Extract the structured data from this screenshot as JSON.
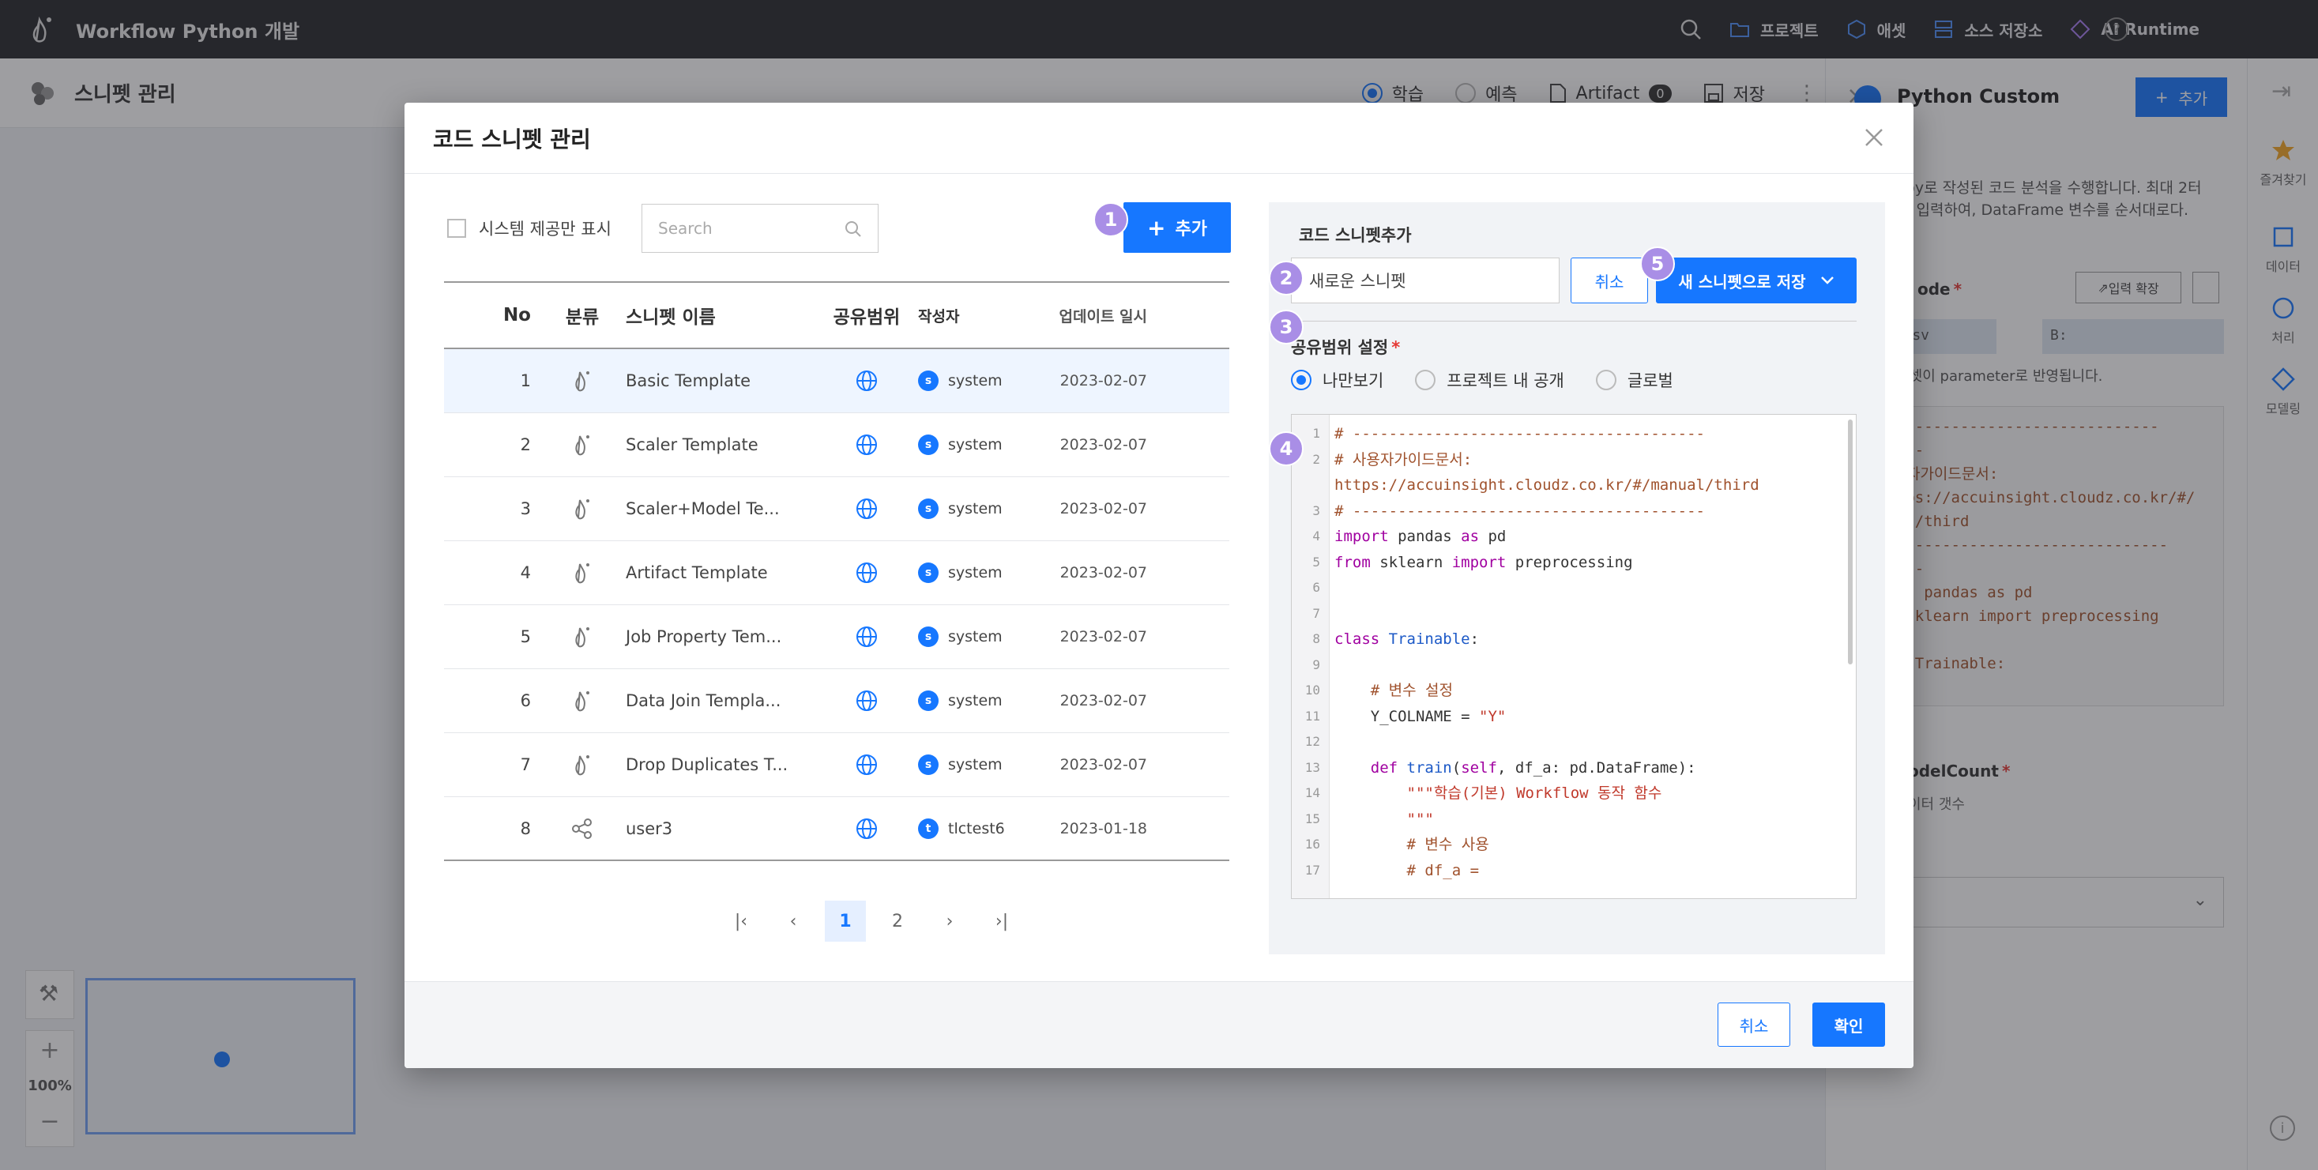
{
  "app": {
    "title": "Workflow Python 개발",
    "nav": [
      {
        "label": "프로젝트",
        "icon": "folder-icon"
      },
      {
        "label": "애셋",
        "icon": "hexagon-icon"
      },
      {
        "label": "소스 저장소",
        "icon": "repository-icon"
      },
      {
        "label": "AI Runtime",
        "icon": "diamond-icon"
      }
    ]
  },
  "subheader": {
    "title": "스니펫 관리",
    "mode_train": "학습",
    "mode_predict": "예측",
    "artifact": "Artifact",
    "artifact_count": "0",
    "save": "저장"
  },
  "right_panel": {
    "title": "Python Custom",
    "add": "추가",
    "desc": "Numpy로 작성된 코드 분석을 수행합니다. 최대 2터 노드를 입력하여, DataFrame 변수를 순서대로다.",
    "code_label": "ode",
    "expand": "입력 확장",
    "file1": "is.csv",
    "file2": "B:",
    "note": "데이터셋이 parameter로 반영됩니다.",
    "code_lines": [
      "-------------------------------",
      "-----",
      "사용자가이드문서:",
      "https://accuinsight.cloudz.co.kr/#/",
      "nual/third",
      "--------------------------------",
      "-----",
      "port pandas as pd",
      "om sklearn import preprocessing",
      "",
      "ass Trainable:"
    ],
    "model_count_label": "odelCount",
    "model_count_desc": "이터 갯수"
  },
  "vbar": [
    {
      "label": "즐겨찾기",
      "icon": "star-icon"
    },
    {
      "label": "데이터",
      "icon": "square-icon"
    },
    {
      "label": "처리",
      "icon": "circle-icon"
    },
    {
      "label": "모델링",
      "icon": "diamond-icon"
    }
  ],
  "canvas": {
    "zoom": "100%"
  },
  "modal": {
    "title": "코드 스니펫 관리",
    "system_only": "시스템 제공만 표시",
    "search_placeholder": "Search",
    "add": "추가",
    "columns": {
      "no": "No",
      "category": "분류",
      "name": "스니펫 이름",
      "scope": "공유범위",
      "author": "작성자",
      "updated": "업데이트 일시"
    },
    "rows": [
      {
        "no": "1",
        "name": "Basic Template",
        "author_initial": "s",
        "author": "system",
        "date": "2023-02-07",
        "cat": "python-icon"
      },
      {
        "no": "2",
        "name": "Scaler Template",
        "author_initial": "s",
        "author": "system",
        "date": "2023-02-07",
        "cat": "python-icon"
      },
      {
        "no": "3",
        "name": "Scaler+Model Te...",
        "author_initial": "s",
        "author": "system",
        "date": "2023-02-07",
        "cat": "python-icon"
      },
      {
        "no": "4",
        "name": "Artifact Template",
        "author_initial": "s",
        "author": "system",
        "date": "2023-02-07",
        "cat": "python-icon"
      },
      {
        "no": "5",
        "name": "Job Property Tem...",
        "author_initial": "s",
        "author": "system",
        "date": "2023-02-07",
        "cat": "python-icon"
      },
      {
        "no": "6",
        "name": "Data Join Templa...",
        "author_initial": "s",
        "author": "system",
        "date": "2023-02-07",
        "cat": "python-icon"
      },
      {
        "no": "7",
        "name": "Drop Duplicates T...",
        "author_initial": "s",
        "author": "system",
        "date": "2023-02-07",
        "cat": "python-icon"
      },
      {
        "no": "8",
        "name": "user3",
        "author_initial": "t",
        "author": "tlctest6",
        "date": "2023-01-18",
        "cat": "share-icon"
      }
    ],
    "pages": [
      "1",
      "2"
    ],
    "current_page": "1",
    "editor": {
      "title": "코드 스니펫추가",
      "name_value": "새로운 스니펫",
      "cancel": "취소",
      "save_as": "새 스니펫으로 저장",
      "scope_label": "공유범위 설정",
      "scope_options": [
        "나만보기",
        "프로젝트 내 공개",
        "글로벌"
      ],
      "scope_selected": "나만보기"
    },
    "footer": {
      "cancel": "취소",
      "confirm": "확인"
    },
    "steps": [
      "1",
      "2",
      "3",
      "4",
      "5"
    ]
  },
  "code": [
    {
      "n": "1",
      "parts": [
        [
          "cm",
          "# ---------------------------------------"
        ]
      ]
    },
    {
      "n": "2",
      "parts": [
        [
          "cm",
          "# 사용자가이드문서:"
        ]
      ]
    },
    {
      "n": "",
      "parts": [
        [
          "cm",
          "https://accuinsight.cloudz.co.kr/#/manual/third"
        ]
      ]
    },
    {
      "n": "3",
      "parts": [
        [
          "cm",
          "# ---------------------------------------"
        ]
      ]
    },
    {
      "n": "4",
      "parts": [
        [
          "kw",
          "import"
        ],
        [
          "",
          " pandas "
        ],
        [
          "kw",
          "as"
        ],
        [
          "",
          " pd"
        ]
      ]
    },
    {
      "n": "5",
      "parts": [
        [
          "kw",
          "from"
        ],
        [
          "",
          " sklearn "
        ],
        [
          "kw",
          "import"
        ],
        [
          "",
          " preprocessing"
        ]
      ]
    },
    {
      "n": "6",
      "parts": [
        [
          "",
          ""
        ]
      ]
    },
    {
      "n": "7",
      "parts": [
        [
          "",
          ""
        ]
      ]
    },
    {
      "n": "8",
      "parts": [
        [
          "kw",
          "class"
        ],
        [
          "",
          " "
        ],
        [
          "cls",
          "Trainable"
        ],
        [
          "",
          ":"
        ]
      ]
    },
    {
      "n": "9",
      "parts": [
        [
          "",
          ""
        ]
      ]
    },
    {
      "n": "10",
      "parts": [
        [
          "",
          "    "
        ],
        [
          "cm",
          "# 변수 설정"
        ]
      ]
    },
    {
      "n": "11",
      "parts": [
        [
          "",
          "    Y_COLNAME = "
        ],
        [
          "str",
          "\"Y\""
        ]
      ]
    },
    {
      "n": "12",
      "parts": [
        [
          "",
          ""
        ]
      ]
    },
    {
      "n": "13",
      "parts": [
        [
          "",
          "    "
        ],
        [
          "kw",
          "def"
        ],
        [
          "",
          " "
        ],
        [
          "fn",
          "train"
        ],
        [
          "",
          "("
        ],
        [
          "kw",
          "self"
        ],
        [
          "",
          ", df_a: pd.DataFrame):"
        ]
      ]
    },
    {
      "n": "14",
      "parts": [
        [
          "",
          "        "
        ],
        [
          "str",
          "\"\"\"학습(기본) Workflow 동작 함수"
        ]
      ]
    },
    {
      "n": "15",
      "parts": [
        [
          "",
          "        "
        ],
        [
          "str",
          "\"\"\""
        ]
      ]
    },
    {
      "n": "16",
      "parts": [
        [
          "",
          "        "
        ],
        [
          "cm",
          "# 변수 사용"
        ]
      ]
    },
    {
      "n": "17",
      "parts": [
        [
          "",
          "        "
        ],
        [
          "cm",
          "# df_a ="
        ]
      ]
    }
  ]
}
